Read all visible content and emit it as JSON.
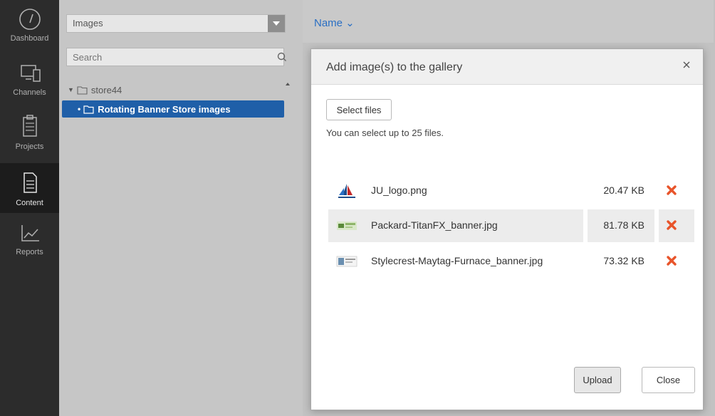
{
  "nav": {
    "items": [
      {
        "label": "Dashboard",
        "icon": "dashboard-gauge-icon"
      },
      {
        "label": "Channels",
        "icon": "channels-devices-icon"
      },
      {
        "label": "Projects",
        "icon": "projects-clipboard-icon"
      },
      {
        "label": "Content",
        "icon": "content-document-icon",
        "active": true
      },
      {
        "label": "Reports",
        "icon": "reports-chart-icon"
      }
    ]
  },
  "tree": {
    "dropdown_value": "Images",
    "search_placeholder": "Search",
    "root": {
      "label": "store44",
      "icon": "folder-icon"
    },
    "selected": {
      "label": "Rotating Banner Store images",
      "icon": "folder-icon"
    }
  },
  "content": {
    "sort_label": "Name ⌄"
  },
  "modal": {
    "title": "Add image(s) to the gallery",
    "close_glyph": "×",
    "select_button": "Select files",
    "hint": "You can select up to 25 files.",
    "files": [
      {
        "name": "JU_logo.png",
        "size": "20.47 KB"
      },
      {
        "name": "Packard-TitanFX_banner.jpg",
        "size": "81.78 KB"
      },
      {
        "name": "Stylecrest-Maytag-Furnace_banner.jpg",
        "size": "73.32 KB"
      }
    ],
    "upload_button": "Upload",
    "close_button": "Close"
  },
  "colors": {
    "nav_bg": "#2c2c2c",
    "selected_bg": "#1f5fa8",
    "accent_link": "#2a6fc4",
    "delete_x": "#e8542a"
  }
}
